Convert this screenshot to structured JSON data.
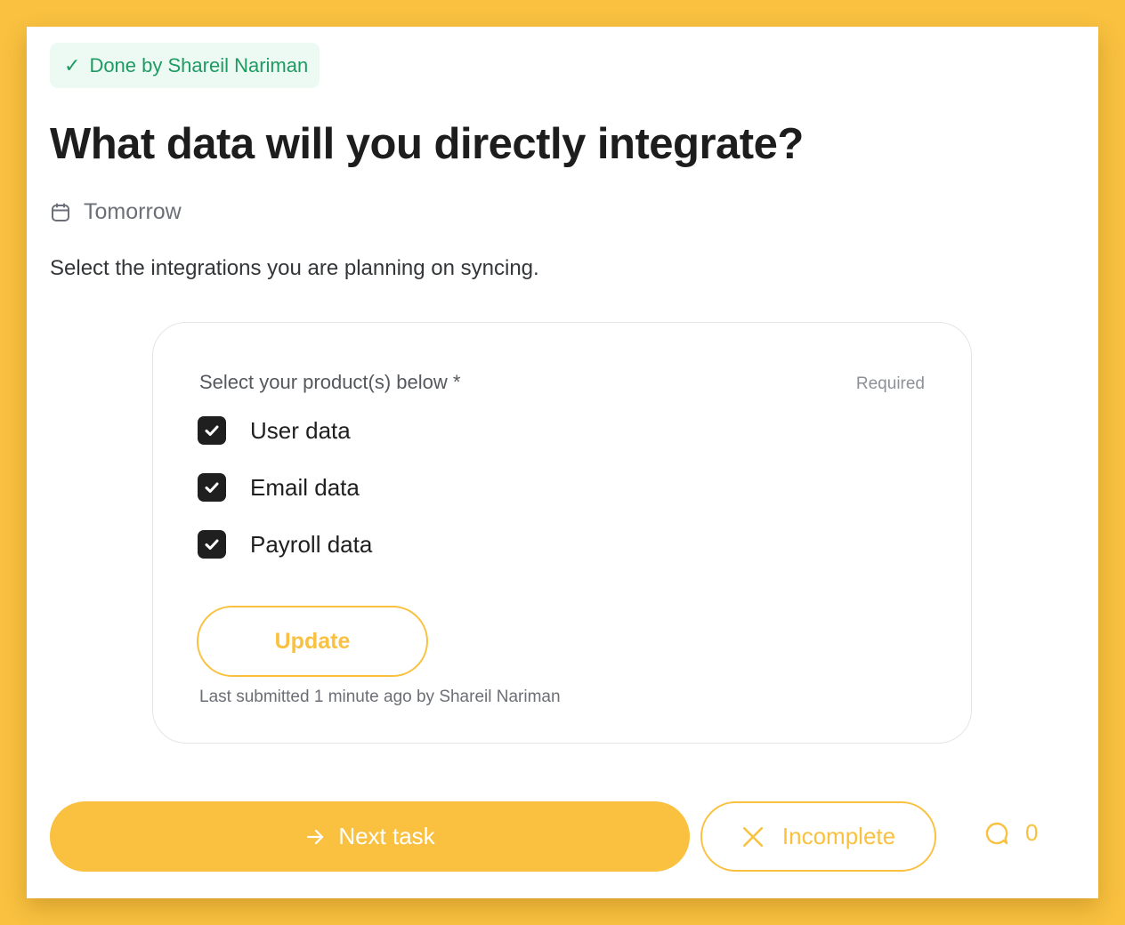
{
  "status": {
    "icon": "check-icon",
    "label": "Done by Shareil Nariman"
  },
  "task": {
    "title": "What data will you directly integrate?",
    "due": "Tomorrow",
    "due_icon": "calendar-icon",
    "description": "Select the integrations you are planning on syncing."
  },
  "form": {
    "label": "Select your product(s) below *",
    "required_text": "Required",
    "options": [
      {
        "label": "User data",
        "checked": true
      },
      {
        "label": "Email data",
        "checked": true
      },
      {
        "label": "Payroll data",
        "checked": true
      }
    ],
    "update_label": "Update",
    "last_submitted": "Last submitted 1 minute ago by Shareil Nariman"
  },
  "actions": {
    "next_label": "Next task",
    "next_icon": "arrow-right-icon",
    "incomplete_label": "Incomplete",
    "incomplete_icon": "close-icon",
    "comment_count": "0",
    "comment_icon": "comment-icon"
  },
  "colors": {
    "accent": "#f9c13f",
    "success": "#1f9a63",
    "success_bg": "#ecfaf3",
    "text_dark": "#1d1d1d",
    "checkbox": "#1f1f1f"
  }
}
